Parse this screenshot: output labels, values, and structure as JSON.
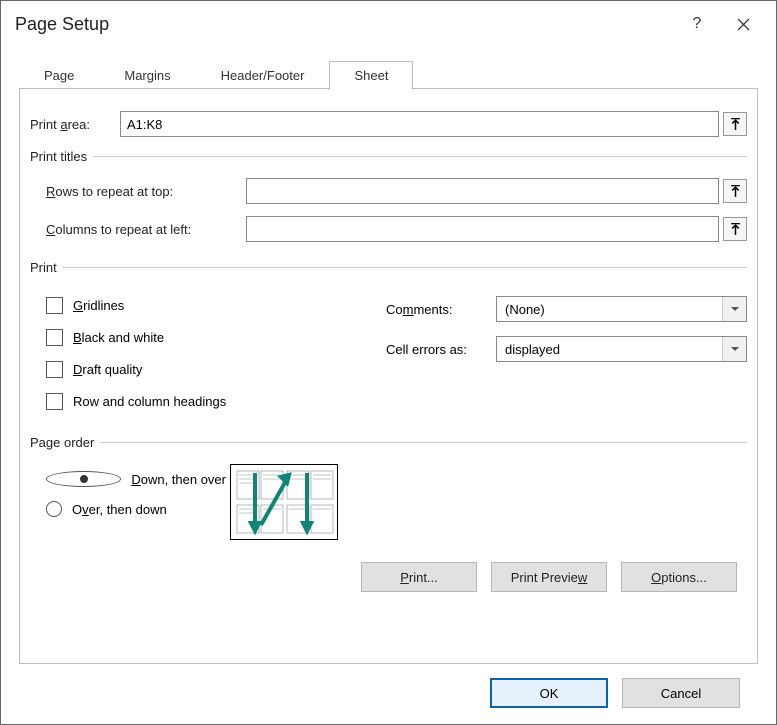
{
  "titlebar": {
    "title": "Page Setup"
  },
  "tabs": {
    "page": "Page",
    "margins": "Margins",
    "headerfooter": "Header/Footer",
    "sheet": "Sheet"
  },
  "print_area": {
    "label_pre": "Print ",
    "label_ul": "a",
    "label_post": "rea:",
    "value": "A1:K8"
  },
  "print_titles": {
    "group_label": "Print titles",
    "rows_label_ul": "R",
    "rows_label_post": "ows to repeat at top:",
    "rows_value": "",
    "cols_label_ul": "C",
    "cols_label_post": "olumns to repeat at left:",
    "cols_value": ""
  },
  "print": {
    "group_label": "Print",
    "gridlines_ul": "G",
    "gridlines_post": "ridlines",
    "bw_ul": "B",
    "bw_post": "lack and white",
    "draft_ul": "D",
    "draft_post": "raft quality",
    "rowcol_label": "Row and column headings",
    "comments_pre": "Co",
    "comments_ul": "m",
    "comments_post": "ments:",
    "comments_value": "(None)",
    "errors_label": "Cell errors as:",
    "errors_value": "displayed"
  },
  "page_order": {
    "group_label": "Page order",
    "down_ul": "D",
    "down_post": "own, then over",
    "over_pre": "O",
    "over_ul": "v",
    "over_post": "er, then down"
  },
  "buttons": {
    "print_ul": "P",
    "print_post": "rint...",
    "preview_pre": "Print Previe",
    "preview_ul": "w",
    "options_ul": "O",
    "options_post": "ptions..."
  },
  "footer": {
    "ok": "OK",
    "cancel": "Cancel"
  }
}
